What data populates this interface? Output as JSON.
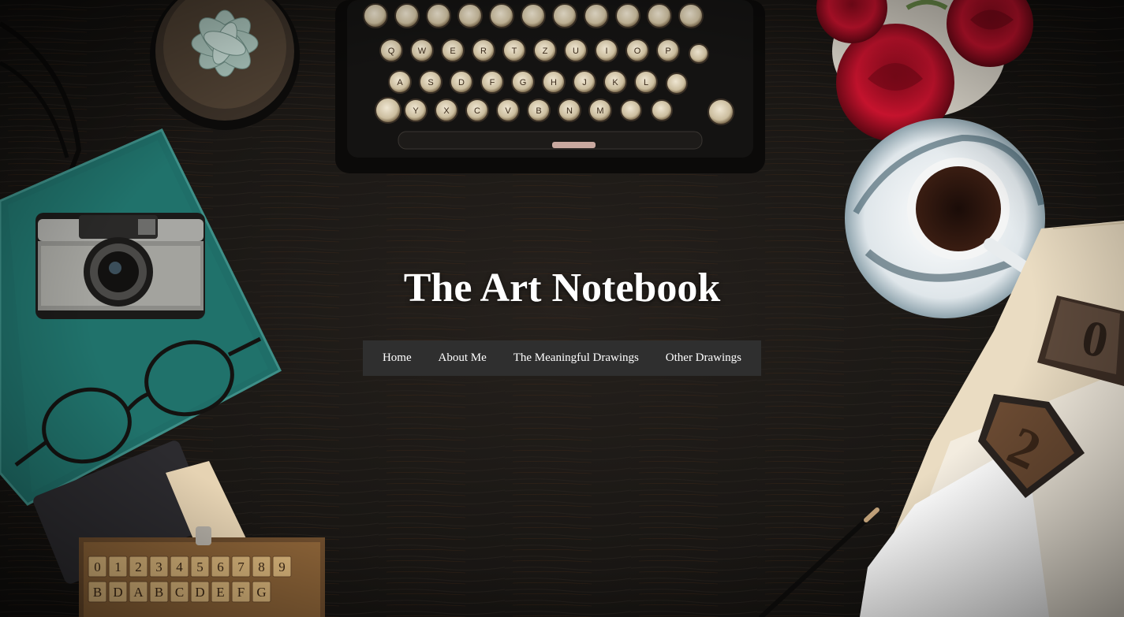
{
  "site": {
    "title": "The Art Notebook"
  },
  "nav": {
    "items": [
      {
        "label": "Home"
      },
      {
        "label": "About Me"
      },
      {
        "label": "The Meaningful Drawings"
      },
      {
        "label": "Other Drawings"
      }
    ]
  },
  "typewriter_keys": {
    "row1": [
      "Q",
      "W",
      "E",
      "R",
      "T",
      "Z",
      "U",
      "I",
      "O",
      "P"
    ],
    "row2": [
      "A",
      "S",
      "D",
      "F",
      "G",
      "H",
      "J",
      "K",
      "L"
    ],
    "row3": [
      "Y",
      "X",
      "C",
      "V",
      "B",
      "N",
      "M"
    ]
  },
  "letterpress_blocks": [
    "0",
    "2"
  ],
  "stamp_rows": {
    "row1": "0123456789",
    "row2": "BDABCDEFG"
  },
  "colors": {
    "background": "#1a1714",
    "nav_background": "#2f2f2f",
    "title_text": "#ffffff",
    "notebook_teal": "#1f6e68",
    "rose_red": "#c0122a"
  },
  "icons": [
    "camera-photo",
    "glasses-photo",
    "succulent-photo",
    "typewriter-photo",
    "roses-photo",
    "coffee-cup-photo",
    "letterpress-photo",
    "pen-photo",
    "stamp-set-photo"
  ]
}
